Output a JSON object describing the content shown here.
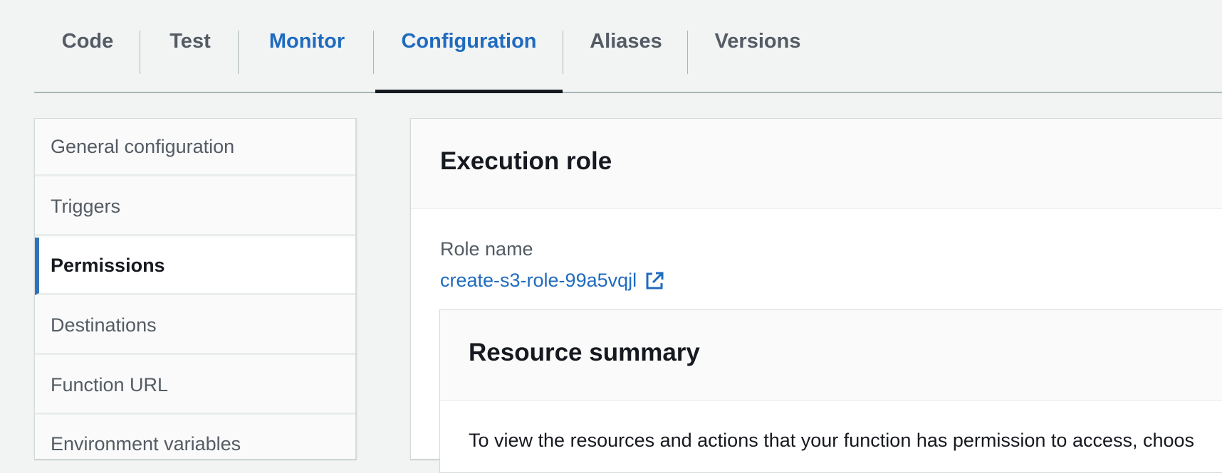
{
  "tabs": [
    {
      "label": "Code"
    },
    {
      "label": "Test"
    },
    {
      "label": "Monitor"
    },
    {
      "label": "Configuration"
    },
    {
      "label": "Aliases"
    },
    {
      "label": "Versions"
    }
  ],
  "active_tab": "Configuration",
  "sidenav": {
    "items": [
      {
        "label": "General configuration"
      },
      {
        "label": "Triggers"
      },
      {
        "label": "Permissions"
      },
      {
        "label": "Destinations"
      },
      {
        "label": "Function URL"
      },
      {
        "label": "Environment variables"
      }
    ],
    "active": "Permissions"
  },
  "execution_role": {
    "title": "Execution role",
    "role_name_label": "Role name",
    "role_name": "create-s3-role-99a5vqjl",
    "role_link_icon": "external-link-icon"
  },
  "resource_summary": {
    "title": "Resource summary",
    "description": "To view the resources and actions that your function has permission to access, choos"
  },
  "colors": {
    "accent_link": "#1f6bbf",
    "active_indicator": "#2e73b8",
    "page_bg": "#f2f3f3"
  }
}
